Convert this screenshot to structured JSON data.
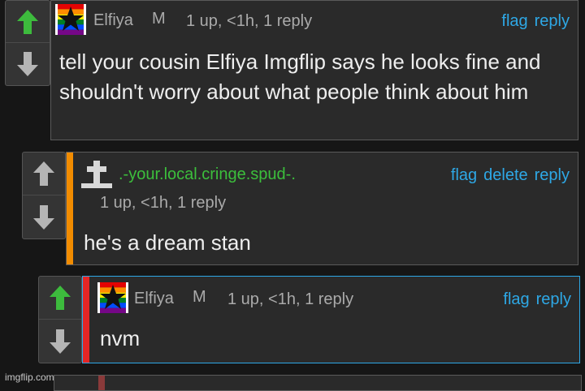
{
  "comments": [
    {
      "username": "Elfiya",
      "username_color": "#aaaaaa",
      "badge": "M",
      "meta": "1 up, <1h, 1 reply",
      "actions": [
        "flag",
        "reply"
      ],
      "body": "tell your cousin Elfiya Imgflip says he looks fine and shouldn't worry about what people think about him",
      "avatar_icon": "pride-flag-star-icon"
    },
    {
      "username": ".-your.local.cringe.spud-.",
      "username_color": "#3cbf3c",
      "meta": "1 up, <1h, 1 reply",
      "actions": [
        "flag",
        "delete",
        "reply"
      ],
      "body": "he's a dream stan",
      "bar_color": "#f28c00",
      "avatar_icon": "gravestone-cross-icon"
    },
    {
      "username": "Elfiya",
      "username_color": "#aaaaaa",
      "badge": "M",
      "meta": "1 up, <1h, 1 reply",
      "actions": [
        "flag",
        "reply"
      ],
      "body": "nvm",
      "bar_color": "#e32525",
      "avatar_icon": "pride-flag-star-icon"
    }
  ],
  "colors": {
    "upvote_active": "#3dbb3d",
    "upvote_idle": "#b5b5b5",
    "downvote": "#b5b5b5",
    "link": "#2ea8e6"
  },
  "watermark": "imgflip.com"
}
